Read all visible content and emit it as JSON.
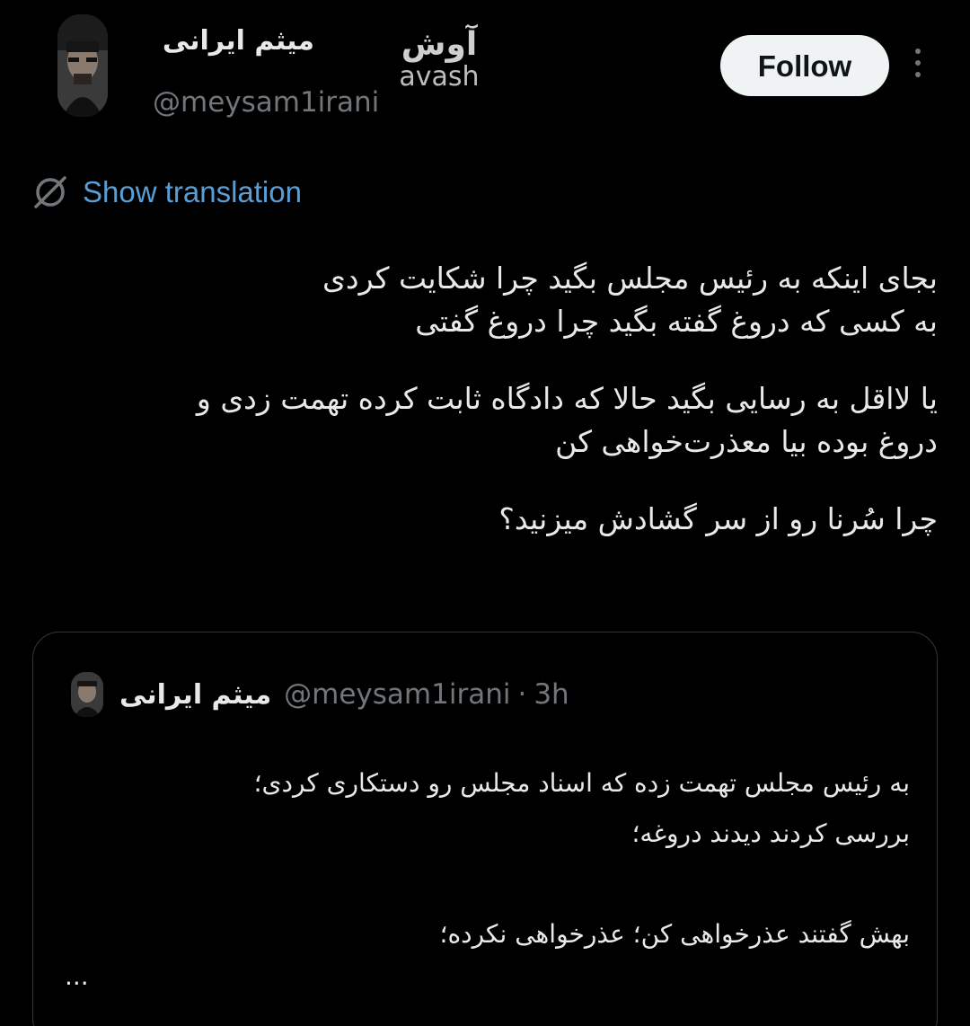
{
  "header": {
    "display_name": "میثم ایرانی",
    "handle": "@meysam1irani",
    "follow_label": "Follow",
    "more_icon": "more-vertical-icon"
  },
  "watermark": {
    "fa": "آوش",
    "en": "avash"
  },
  "translation": {
    "icon": "globe-icon",
    "label": "Show translation",
    "color": "#5b9ed6"
  },
  "tweet": {
    "lines": [
      "بجای اینکه به رئیس مجلس بگید چرا شکایت کردی",
      "به کسی که دروغ گفته بگید چرا دروغ گفتی",
      "یا لااقل به رسایی بگید حالا که دادگاه ثابت کرده تهمت زدی و",
      "دروغ بوده بیا معذرت‌خواهی کن",
      "چرا سُرنا رو از سر گشادش میزنید؟"
    ]
  },
  "quote": {
    "display_name": "میثم ایرانی",
    "handle": "@meysam1irani",
    "separator": "·",
    "time": "3h",
    "lines": [
      "به رئیس مجلس تهمت زده که اسناد مجلس رو دستکاری کردی؛",
      "بررسی کردند دیدند دروغه؛",
      "بهش گفتند عذرخواهی کن؛ عذرخواهی نکرده؛"
    ],
    "truncation": "..."
  },
  "colors": {
    "background": "#000000",
    "text": "#e7e9ea",
    "muted": "#71767b",
    "button_bg": "#eff3f4",
    "border": "#333639"
  }
}
